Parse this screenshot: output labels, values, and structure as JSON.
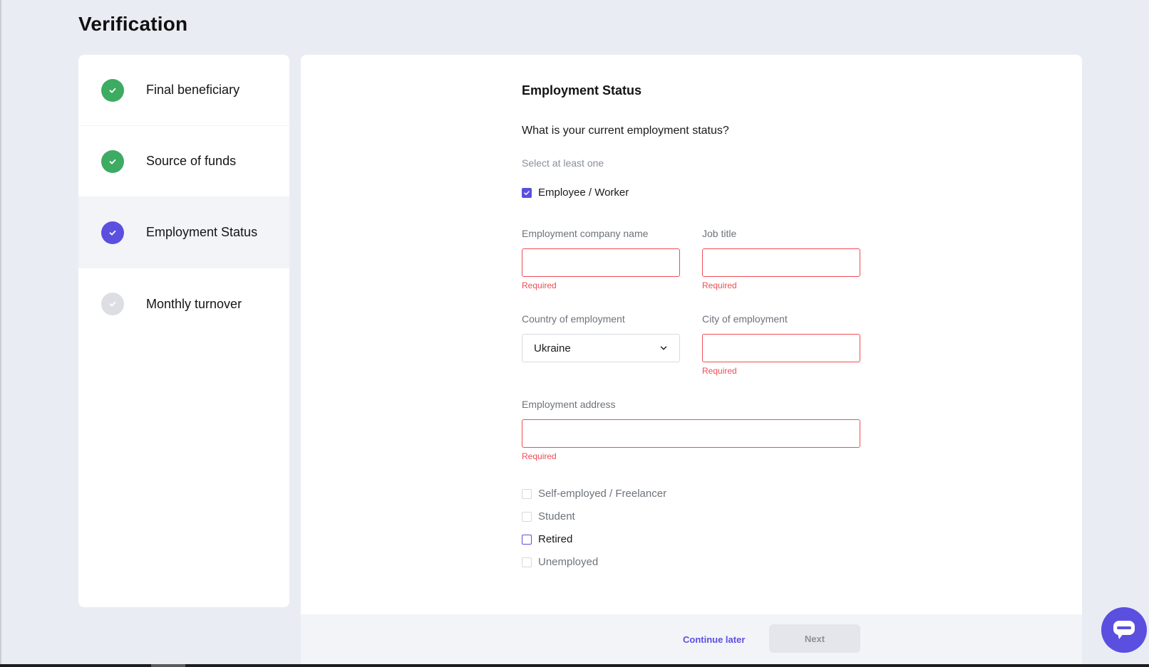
{
  "page": {
    "title": "Verification"
  },
  "sidebar": {
    "steps": [
      {
        "label": "Final beneficiary",
        "status": "complete",
        "icon": "check-icon",
        "color": "#3dab62"
      },
      {
        "label": "Source of funds",
        "status": "complete",
        "icon": "check-icon",
        "color": "#3dab62"
      },
      {
        "label": "Employment Status",
        "status": "current",
        "icon": "check-icon",
        "color": "#5b4fe0"
      },
      {
        "label": "Monthly turnover",
        "status": "pending",
        "icon": "check-icon",
        "color": "#d9dbe0"
      }
    ]
  },
  "form": {
    "section_title": "Employment Status",
    "question": "What is your current employment status?",
    "hint": "Select at least one",
    "options": [
      {
        "label": "Employee / Worker",
        "checked": true
      },
      {
        "label": "Self-employed / Freelancer",
        "checked": false
      },
      {
        "label": "Student",
        "checked": false
      },
      {
        "label": "Retired",
        "checked": false
      },
      {
        "label": "Unemployed",
        "checked": false
      }
    ],
    "fields": {
      "company_name": {
        "label": "Employment company name",
        "value": "",
        "error": "Required"
      },
      "job_title": {
        "label": "Job title",
        "value": "",
        "error": "Required"
      },
      "country": {
        "label": "Country of employment",
        "value": "Ukraine"
      },
      "city": {
        "label": "City of employment",
        "value": "",
        "error": "Required"
      },
      "address": {
        "label": "Employment address",
        "value": "",
        "error": "Required"
      }
    }
  },
  "footer": {
    "continue_later": "Continue later",
    "next": "Next"
  },
  "colors": {
    "accent": "#5b4fe0",
    "success": "#3dab62",
    "error": "#ef4d55",
    "background": "#e9edf3"
  },
  "chat": {
    "icon": "chat-bubble-icon"
  }
}
